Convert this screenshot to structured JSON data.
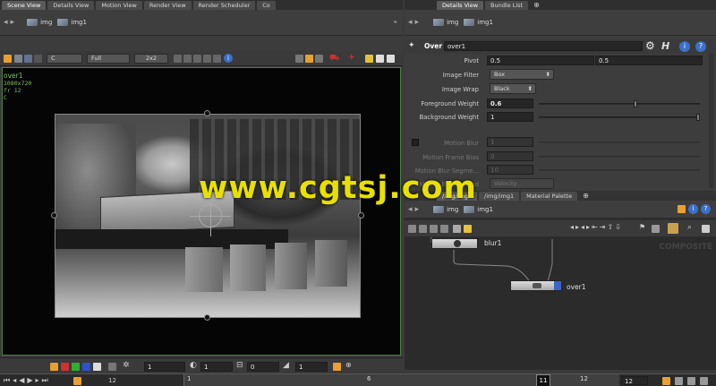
{
  "left_tabs": [
    "Scene View",
    "Details View",
    "Motion View",
    "Render View",
    "Render Scheduler",
    "Co"
  ],
  "right_tabs": [
    "Details View",
    "Bundle List"
  ],
  "path": {
    "root": "img",
    "node": "img1"
  },
  "viewer_toolbar": {
    "channel": "C",
    "resolution": "Full",
    "scale": "2x2"
  },
  "viewer_info": {
    "node": "over1",
    "size": "1080x720",
    "frame": "fr 12",
    "plane": "C"
  },
  "params_header": {
    "type": "Over",
    "name": "over1"
  },
  "params": {
    "pivot": {
      "label": "Pivot",
      "x": "0.5",
      "y": "0.5"
    },
    "image_filter": {
      "label": "Image Filter",
      "value": "Box"
    },
    "image_wrap": {
      "label": "Image Wrap",
      "value": "Black"
    },
    "fg_weight": {
      "label": "Foreground Weight",
      "value": "0.6",
      "slider": 0.6
    },
    "bg_weight": {
      "label": "Background Weight",
      "value": "1",
      "slider": 1.0
    },
    "motion_blur": {
      "label": "Motion Blur",
      "value": "1"
    },
    "motion_frame_bias": {
      "label": "Motion Frame Bias",
      "value": "0"
    },
    "motion_blur_segments": {
      "label": "Motion Blur Segme...",
      "value": "10"
    },
    "motion_blur_method": {
      "label": "Motion Blur Method",
      "value": "Velocity"
    }
  },
  "watermark": "www.cgtsj.com",
  "network_tabs": [
    "/img/img1",
    "/img/img1",
    "Material Palette"
  ],
  "network_path": {
    "root": "img",
    "node": "img1"
  },
  "nodes": {
    "blur": "blur1",
    "over": "over1"
  },
  "network_bg_text": "COMPOSITE",
  "bottom_toolbar": {
    "field1": "1",
    "field2": "1",
    "field3": "0",
    "field4": "1"
  },
  "timeline": {
    "ticks": [
      "1",
      "6",
      "12"
    ],
    "current": "11",
    "frame_input": "12",
    "left_label": "12"
  },
  "colors": {
    "accent_orange": "#e8a030",
    "viewer_bg": "#050505",
    "over_node": "#3a66c8"
  }
}
